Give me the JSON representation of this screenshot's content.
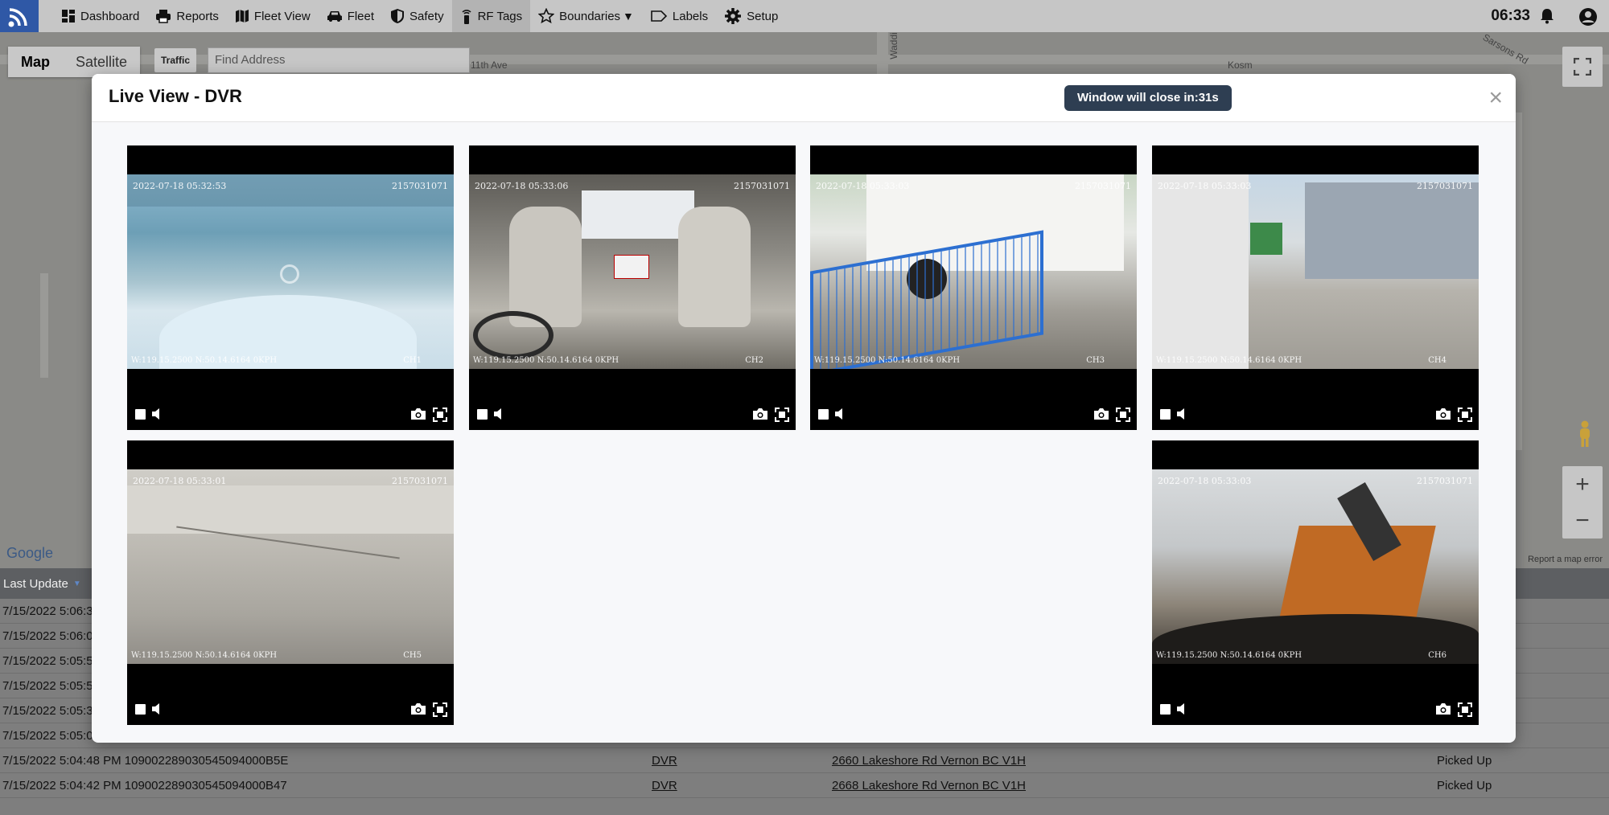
{
  "nav": {
    "items": [
      {
        "label": "Dashboard",
        "icon": "dashboard-icon"
      },
      {
        "label": "Reports",
        "icon": "printer-icon"
      },
      {
        "label": "Fleet View",
        "icon": "map-icon"
      },
      {
        "label": "Fleet",
        "icon": "car-icon"
      },
      {
        "label": "Safety",
        "icon": "shield-icon"
      },
      {
        "label": "RF Tags",
        "icon": "rf-tag-icon"
      },
      {
        "label": "Boundaries",
        "icon": "star-icon"
      },
      {
        "label": "Labels",
        "icon": "label-icon"
      },
      {
        "label": "Setup",
        "icon": "gear-icon"
      }
    ],
    "boundaries_caret": "▼",
    "clock": "06:33"
  },
  "map": {
    "map_label": "Map",
    "satellite_label": "Satellite",
    "traffic_label": "Traffic",
    "address_placeholder": "Find Address",
    "street_11th": "11th Ave",
    "street_kosm": "Kosm",
    "street_sarsons": "Sarsons Rd",
    "street_waddi": "Waddi",
    "google": "Google",
    "attribution": "Report a map error"
  },
  "table": {
    "header_last_update": "Last Update",
    "rows": [
      {
        "c1": "7/15/2022 5:06:3",
        "c2": "",
        "c3": "",
        "c4": ""
      },
      {
        "c1": "7/15/2022 5:06:0",
        "c2": "",
        "c3": "",
        "c4": ""
      },
      {
        "c1": "7/15/2022 5:05:5",
        "c2": "",
        "c3": "",
        "c4": ""
      },
      {
        "c1": "7/15/2022 5:05:5",
        "c2": "",
        "c3": "",
        "c4": ""
      },
      {
        "c1": "7/15/2022 5:05:3",
        "c2": "",
        "c3": "",
        "c4": ""
      },
      {
        "c1": "7/15/2022 5:05:0",
        "c2": "",
        "c3": "",
        "c4": ""
      },
      {
        "c1": "7/15/2022 5:04:48 PM 109002289030545094000B5E",
        "c2": "DVR",
        "c3": "2660 Lakeshore Rd Vernon BC V1H",
        "c4": "Picked Up"
      },
      {
        "c1": "7/15/2022 5:04:42 PM 109002289030545094000B47",
        "c2": "DVR",
        "c3": "2668 Lakeshore Rd Vernon BC V1H",
        "c4": "Picked Up"
      }
    ]
  },
  "modal": {
    "title": "Live View - DVR",
    "close_timer": "Window will close in:31s",
    "close_symbol": "×"
  },
  "cameras": [
    {
      "timestamp": "2022-07-18 05:32:53",
      "serial": "2157031071",
      "gps": "W:119.15.2500 N:50.14.6164 0KPH",
      "channel": "CH1"
    },
    {
      "timestamp": "2022-07-18 05:33:06",
      "serial": "2157031071",
      "gps": "W:119.15.2500 N:50.14.6164 0KPH",
      "channel": "CH2"
    },
    {
      "timestamp": "2022-07-18 05:33:03",
      "serial": "2157031071",
      "gps": "W:119.15.2500 N:50.14.6164 0KPH",
      "channel": "CH3"
    },
    {
      "timestamp": "2022-07-18 05:33:03",
      "serial": "2157031071",
      "gps": "W:119.15.2500 N:50.14.6164 0KPH",
      "channel": "CH4"
    },
    {
      "timestamp": "2022-07-18 05:33:01",
      "serial": "2157031071",
      "gps": "W:119.15.2500 N:50.14.6164 0KPH",
      "channel": "CH5"
    },
    {
      "timestamp": "2022-07-18 05:33:03",
      "serial": "2157031071",
      "gps": "W:119.15.2500 N:50.14.6164 0KPH",
      "channel": "CH6"
    }
  ],
  "colors": {
    "nav_bg": "#c6c6c6",
    "logo_bg": "#2f58a6",
    "badge_bg": "#2e3e52",
    "table_header_bg": "#5d5f62"
  }
}
